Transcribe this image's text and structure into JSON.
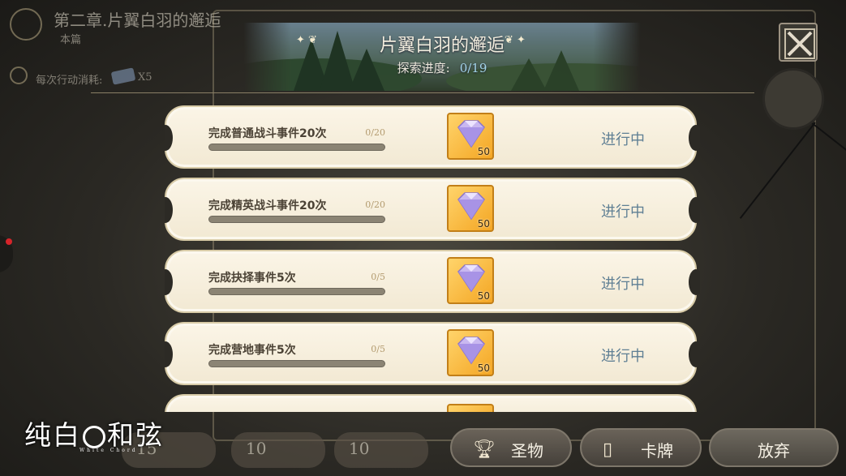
{
  "background": {
    "chapter_title": "第二章.片翼白羽的邂逅",
    "chapter_sub": "本篇",
    "cost_label": "每次行动消耗:",
    "cost_value": "X5"
  },
  "header": {
    "title": "片翼白羽的邂逅",
    "progress_label": "探索进度:",
    "progress_value": "0/19"
  },
  "tasks": [
    {
      "name": "完成普通战斗事件20次",
      "count": "0/20",
      "progress": 0,
      "reward_icon": "diamond-gem-icon",
      "reward_qty": "50",
      "status": "进行中"
    },
    {
      "name": "完成精英战斗事件20次",
      "count": "0/20",
      "progress": 0,
      "reward_icon": "diamond-gem-icon",
      "reward_qty": "50",
      "status": "进行中"
    },
    {
      "name": "完成抉择事件5次",
      "count": "0/5",
      "progress": 0,
      "reward_icon": "diamond-gem-icon",
      "reward_qty": "50",
      "status": "进行中"
    },
    {
      "name": "完成营地事件5次",
      "count": "0/5",
      "progress": 0,
      "reward_icon": "diamond-gem-icon",
      "reward_qty": "50",
      "status": "进行中"
    }
  ],
  "bottom": {
    "portraits": [
      "15",
      "10",
      "10"
    ],
    "relic_label": "圣物",
    "cards_label": "卡牌",
    "abandon_label": "放弃"
  },
  "logo": {
    "text_left": "纯白",
    "text_right": "和弦",
    "sub": "White Chord"
  },
  "colors": {
    "status": "#5f7f94",
    "reward_bg": "#f4a624",
    "card_bg": "#f6eedc"
  }
}
